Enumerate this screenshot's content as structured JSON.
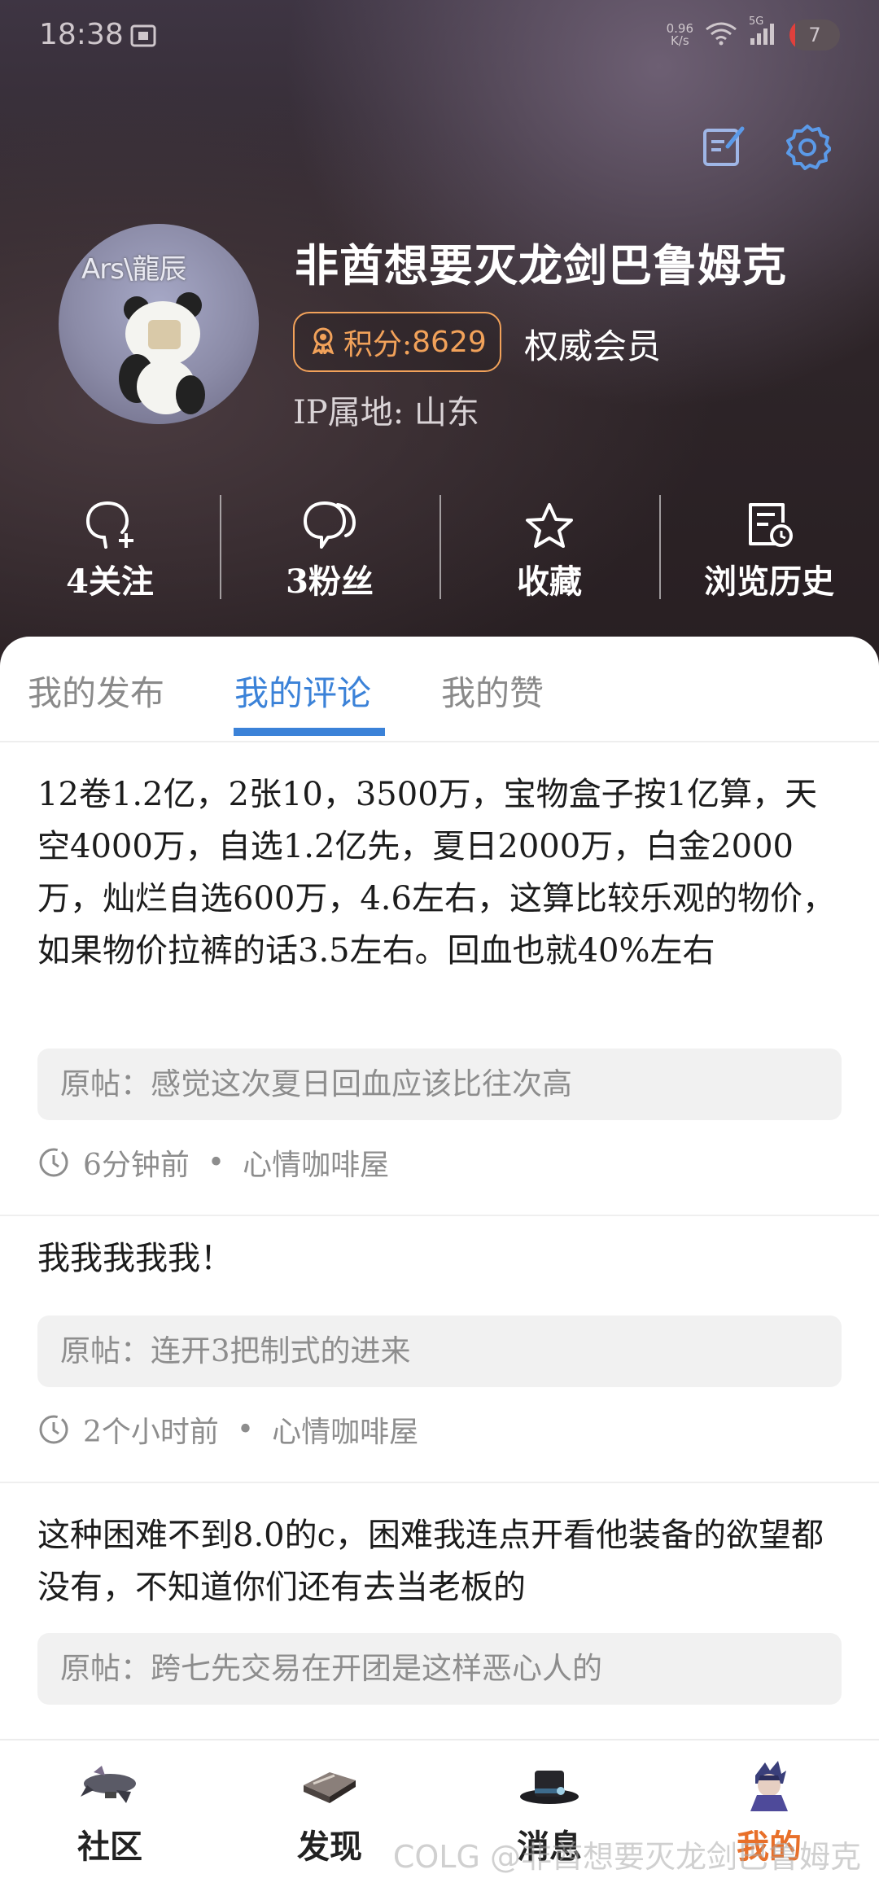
{
  "status_bar": {
    "time": "18:38",
    "net_speed_value": "0.96",
    "net_speed_unit": "K/s",
    "network": "5G",
    "battery": "7",
    "battery_fraction": 0.07
  },
  "profile": {
    "avatar_text": "Ars\\龍辰",
    "username": "非酋想要灭龙剑巴鲁姆克",
    "points_label": "积分:",
    "points_value": "8629",
    "member_badge": "权威会员",
    "ip_location": "IP属地: 山东"
  },
  "stats": [
    {
      "label": "4关注",
      "icon": "user-plus-icon"
    },
    {
      "label": "3粉丝",
      "icon": "users-icon"
    },
    {
      "label": "收藏",
      "icon": "star-icon"
    },
    {
      "label": "浏览历史",
      "icon": "history-icon"
    }
  ],
  "tabs": [
    {
      "label": "我的发布",
      "active": false
    },
    {
      "label": "我的评论",
      "active": true
    },
    {
      "label": "我的赞",
      "active": false
    }
  ],
  "comments": [
    {
      "text": "12卷1.2亿，2张10，3500万，宝物盒子按1亿算，天空4000万，自选1.2亿先，夏日2000万，白金2000万，灿烂自选600万，4.6左右，这算比较乐观的物价，如果物价拉裤的话3.5左右。回血也就40%左右",
      "original": "原帖：感觉这次夏日回血应该比往次高",
      "time": "6分钟前",
      "board": "心情咖啡屋"
    },
    {
      "text": "我我我我我！",
      "original": "原帖：连开3把制式的进来",
      "time": "2个小时前",
      "board": "心情咖啡屋"
    },
    {
      "text": "这种困难不到8.0的c，困难我连点开看他装备的欲望都没有，不知道你们还有去当老板的",
      "original": "原帖：跨七先交易在开团是这样恶心人的",
      "time": "",
      "board": ""
    }
  ],
  "bottom_nav": [
    {
      "label": "社区",
      "icon": "airship-icon",
      "active": false
    },
    {
      "label": "发现",
      "icon": "book-icon",
      "active": false
    },
    {
      "label": "消息",
      "icon": "top-hat-icon",
      "active": false
    },
    {
      "label": "我的",
      "icon": "character-avatar-icon",
      "active": true
    }
  ],
  "watermark": "COLG @非酋想要灭龙剑巴鲁姆克",
  "colors": {
    "accent_blue": "#3b82d8",
    "points_orange": "#f2a25a",
    "nav_active": "#e8702a"
  }
}
